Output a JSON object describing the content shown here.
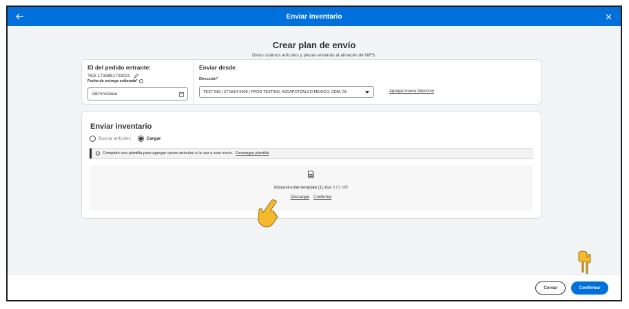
{
  "header": {
    "title": "Enviar inventario",
    "back_icon": "arrow-left-icon",
    "close_icon": "close-icon"
  },
  "intro": {
    "title": "Crear plan de envío",
    "subtitle": "Dinos cuántos artículos y piezas enviarás al almacén de WFS."
  },
  "order": {
    "id_label": "ID del pedido entrante:",
    "id_value": "TES-1733851729021",
    "date_label": "Fecha de entrega estimada*",
    "date_placeholder": "dd/mm/aaaa"
  },
  "ship_from": {
    "title": "Enviar desde",
    "address_label": "Dirección*",
    "address_value": "TEST ING | 57 5814-5006 | PROD TESTING, AZCAPOTZALCO MEXICO, CDM, 02:",
    "add_address_link": "Agregar nueva dirección"
  },
  "inventory": {
    "title": "Enviar inventario",
    "options": [
      {
        "label": "Buscar artículos",
        "selected": false
      },
      {
        "label": "Cargar",
        "selected": true
      }
    ],
    "banner_text": "Complete una plantilla para agregar varios artículos a la vez a este envío.",
    "banner_link": "Descargar plantilla",
    "file_name": "inbound-order-template (1).xlsx",
    "file_size": "0.01 MB",
    "download_label": "Descargar",
    "confirm_label": "Confirmar"
  },
  "footer": {
    "cancel_label": "Cerrar",
    "confirm_label": "Confirmar"
  },
  "colors": {
    "primary": "#0071dc",
    "pointer": "#f6b92b"
  }
}
